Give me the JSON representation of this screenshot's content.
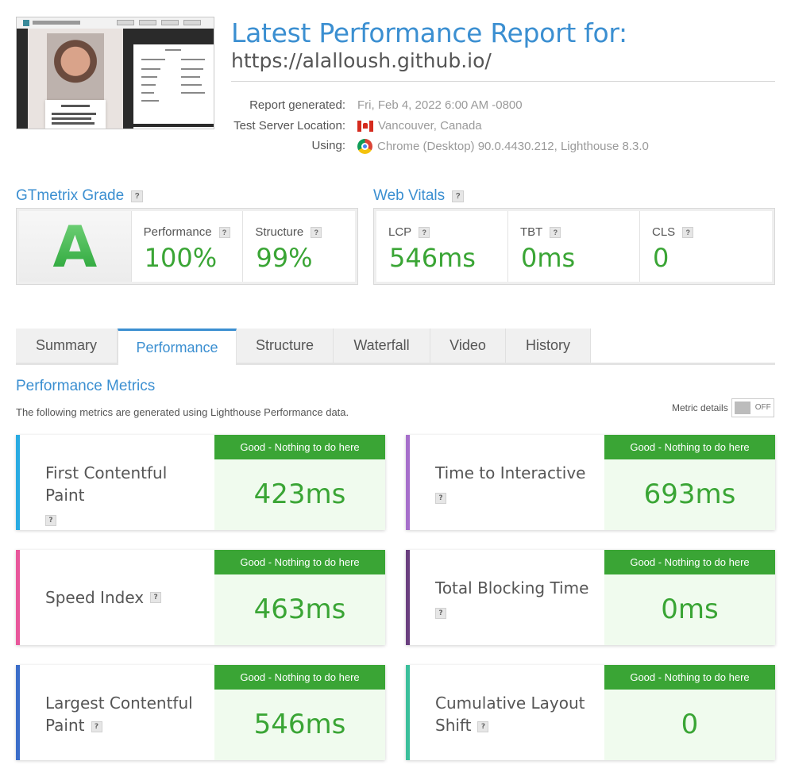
{
  "header": {
    "title": "Latest Performance Report for:",
    "url": "https://alalloush.github.io/",
    "meta": [
      {
        "label": "Report generated:",
        "value": "Fri, Feb 4, 2022 6:00 AM -0800",
        "icon": ""
      },
      {
        "label": "Test Server Location:",
        "value": "Vancouver, Canada",
        "icon": "canada-flag-icon"
      },
      {
        "label": "Using:",
        "value": "Chrome (Desktop) 90.0.4430.212, Lighthouse 8.3.0",
        "icon": "chrome-icon"
      }
    ]
  },
  "grade": {
    "heading": "GTmetrix Grade",
    "letter": "A",
    "performance_label": "Performance",
    "performance_value": "100%",
    "structure_label": "Structure",
    "structure_value": "99%"
  },
  "web_vitals": {
    "heading": "Web Vitals",
    "items": [
      {
        "label": "LCP",
        "value": "546ms"
      },
      {
        "label": "TBT",
        "value": "0ms"
      },
      {
        "label": "CLS",
        "value": "0"
      }
    ]
  },
  "tabs": [
    "Summary",
    "Performance",
    "Structure",
    "Waterfall",
    "Video",
    "History"
  ],
  "active_tab": "Performance",
  "metrics_section": {
    "title": "Performance Metrics",
    "description": "The following metrics are generated using Lighthouse Performance data.",
    "details_label": "Metric details",
    "toggle_state": "OFF"
  },
  "metrics": [
    {
      "name": "First Contentful Paint",
      "status": "Good - Nothing to do here",
      "value": "423ms",
      "color": "#29abe2"
    },
    {
      "name": "Time to Interactive",
      "status": "Good - Nothing to do here",
      "value": "693ms",
      "color": "#a66fcb"
    },
    {
      "name": "Speed Index",
      "status": "Good - Nothing to do here",
      "value": "463ms",
      "color": "#e8579b"
    },
    {
      "name": "Total Blocking Time",
      "status": "Good - Nothing to do here",
      "value": "0ms",
      "color": "#6a3f7f"
    },
    {
      "name": "Largest Contentful Paint",
      "status": "Good - Nothing to do here",
      "value": "546ms",
      "color": "#3b6dc9"
    },
    {
      "name": "Cumulative Layout Shift",
      "status": "Good - Nothing to do here",
      "value": "0",
      "color": "#3bbf9b"
    }
  ],
  "colors": {
    "accent": "#3b8fd1",
    "good": "#3aa535"
  }
}
